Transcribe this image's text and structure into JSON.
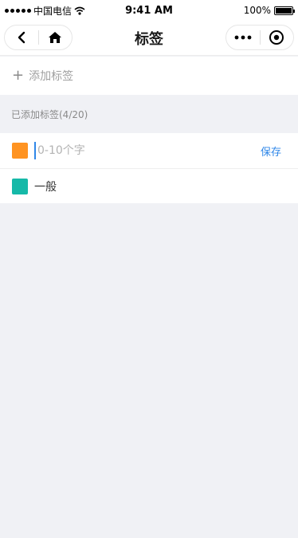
{
  "status_bar": {
    "carrier": "中国电信",
    "time": "9:41 AM",
    "battery_text": "100%",
    "battery_level": 1.0
  },
  "nav": {
    "title": "标签",
    "icons": [
      "back-chevron-icon",
      "home-icon",
      "more-dots-icon",
      "target-circle-icon"
    ]
  },
  "add_tag": {
    "label": "添加标签",
    "icon": "plus-icon"
  },
  "section": {
    "header": "已添加标签(4/20)"
  },
  "new_tag": {
    "placeholder": "0-10个字",
    "value": "",
    "color": "#ff9321",
    "save_label": "保存"
  },
  "tags": [
    {
      "label": "一般",
      "color": "#16b9a8"
    }
  ],
  "colors": {
    "accent": "#2f87e8",
    "background": "#f0f1f5"
  }
}
